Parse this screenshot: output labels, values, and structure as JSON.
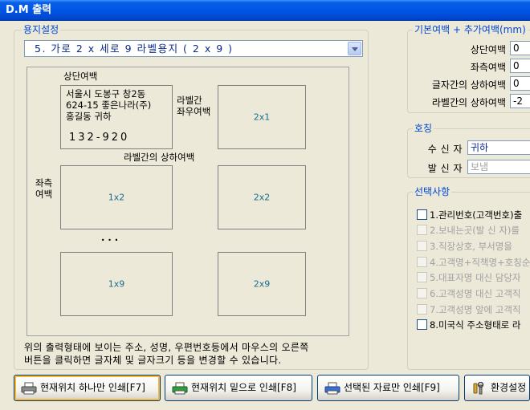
{
  "window": {
    "title": "D.M 출력"
  },
  "paper_group": {
    "legend": "용지설정",
    "selected_paper": "5. 가로 2 x 세로 9   라벨용지 ( 2 x 9 )"
  },
  "preview": {
    "top_margin": "상단여백",
    "h_gap_line1": "라벨간",
    "h_gap_line2": "좌우여백",
    "v_gap": "라벨간의 상하여백",
    "left_margin_line1": "좌측",
    "left_margin_line2": "여백",
    "address_line1": "서울시 도봉구 창2동",
    "address_line2": "624-15 좋은나라(주)",
    "address_line3": "홍길동 귀하",
    "zip": "132-920",
    "labels": [
      "2x1",
      "1x2",
      "2x2",
      "1x9",
      "2x9"
    ],
    "ellipsis": "· · ·"
  },
  "note": {
    "line1": "위의 출력형태에 보이는 주소, 성명, 우편번호등에서 마우스의 오른쪽",
    "line2": "버튼을 클릭하면 글자체 및 글자크기 등을 변경할 수 있습니다."
  },
  "margin_group": {
    "legend": "기본여백 + 추가여백(mm)",
    "rows": [
      {
        "label": "상단여백",
        "value": "0"
      },
      {
        "label": "좌측여백",
        "value": "0"
      },
      {
        "label": "글자간의 상하여백",
        "value": "0"
      },
      {
        "label": "라벨간의 상하여백",
        "value": "-2"
      }
    ]
  },
  "title_group": {
    "legend": "호칭",
    "receiver_label": "수 신 자",
    "receiver_value": "귀하",
    "sender_label": "발 신 자",
    "sender_value": "보냄"
  },
  "options_group": {
    "legend": "선택사항",
    "items": [
      {
        "label": "1.관리번호(고객번호)출",
        "enabled": true
      },
      {
        "label": "2.보내는곳(발 신 자)를",
        "enabled": false
      },
      {
        "label": "3.직장상호, 부서명을",
        "enabled": false
      },
      {
        "label": "4.고객명+직책명+호칭순",
        "enabled": false
      },
      {
        "label": "5.대표자명 대신 담당자",
        "enabled": false
      },
      {
        "label": "6.고객성명 대신 고객직",
        "enabled": false
      },
      {
        "label": "7.고객성명 앞에 고객직",
        "enabled": false
      },
      {
        "label": "8.미국식 주소형태로 라",
        "enabled": true
      }
    ]
  },
  "buttons": {
    "print_one": "현재위치 하나만 인쇄[F7]",
    "print_below": "현재위치 밑으로 인쇄[F8]",
    "print_selected": "선택된 자료만 인쇄[F9]",
    "settings": "환경설정"
  }
}
